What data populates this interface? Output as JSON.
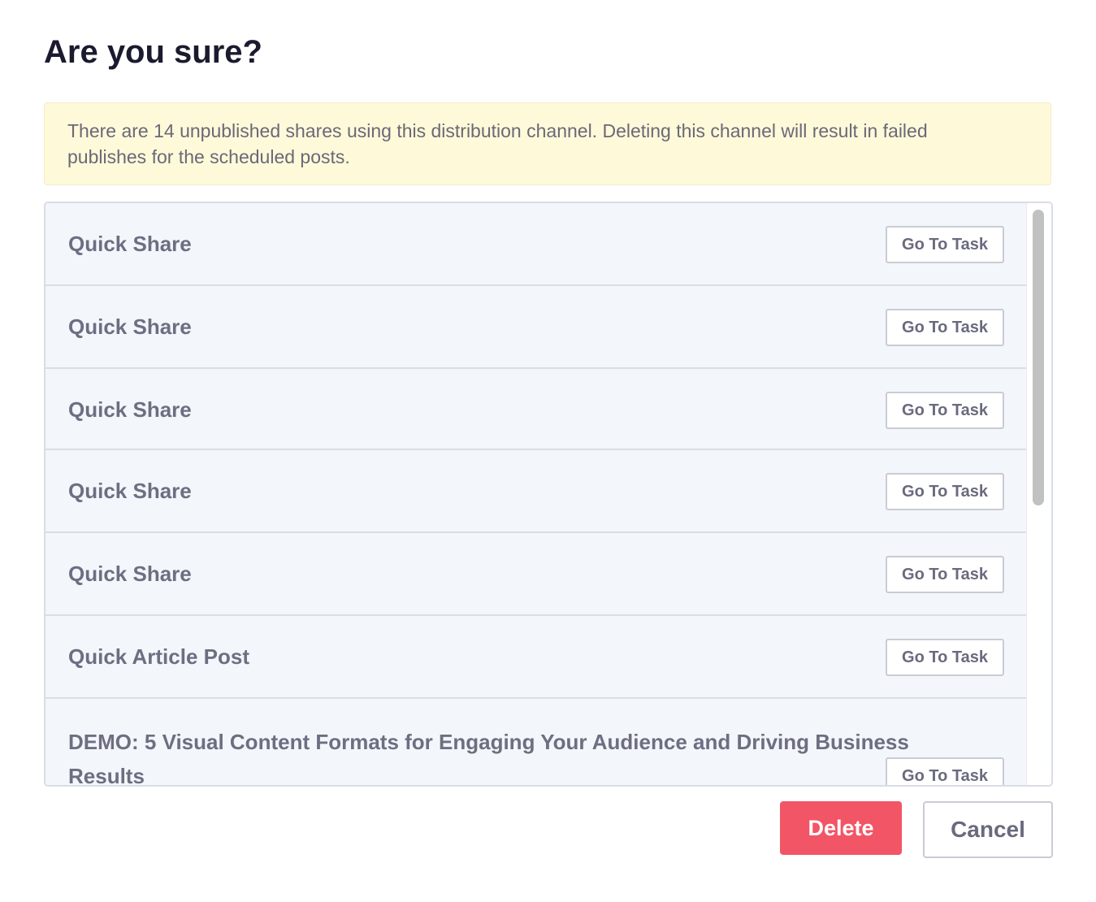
{
  "dialog": {
    "title": "Are you sure?",
    "warning": "There are 14 unpublished shares using this distribution channel. Deleting this channel will result in failed publishes for the scheduled posts."
  },
  "shares": [
    {
      "title": "Quick Share",
      "button_label": "Go To Task"
    },
    {
      "title": "Quick Share",
      "button_label": "Go To Task"
    },
    {
      "title": "Quick Share",
      "button_label": "Go To Task"
    },
    {
      "title": "Quick Share",
      "button_label": "Go To Task"
    },
    {
      "title": "Quick Share",
      "button_label": "Go To Task"
    },
    {
      "title": "Quick Article Post",
      "button_label": "Go To Task"
    },
    {
      "title": "DEMO: 5 Visual Content Formats for Engaging Your Audience and Driving Business Results",
      "button_label": "Go To Task"
    }
  ],
  "actions": {
    "delete_label": "Delete",
    "cancel_label": "Cancel"
  },
  "colors": {
    "delete": "#f25566",
    "warning_bg": "#fefad9",
    "row_bg": "#f3f6fa"
  }
}
